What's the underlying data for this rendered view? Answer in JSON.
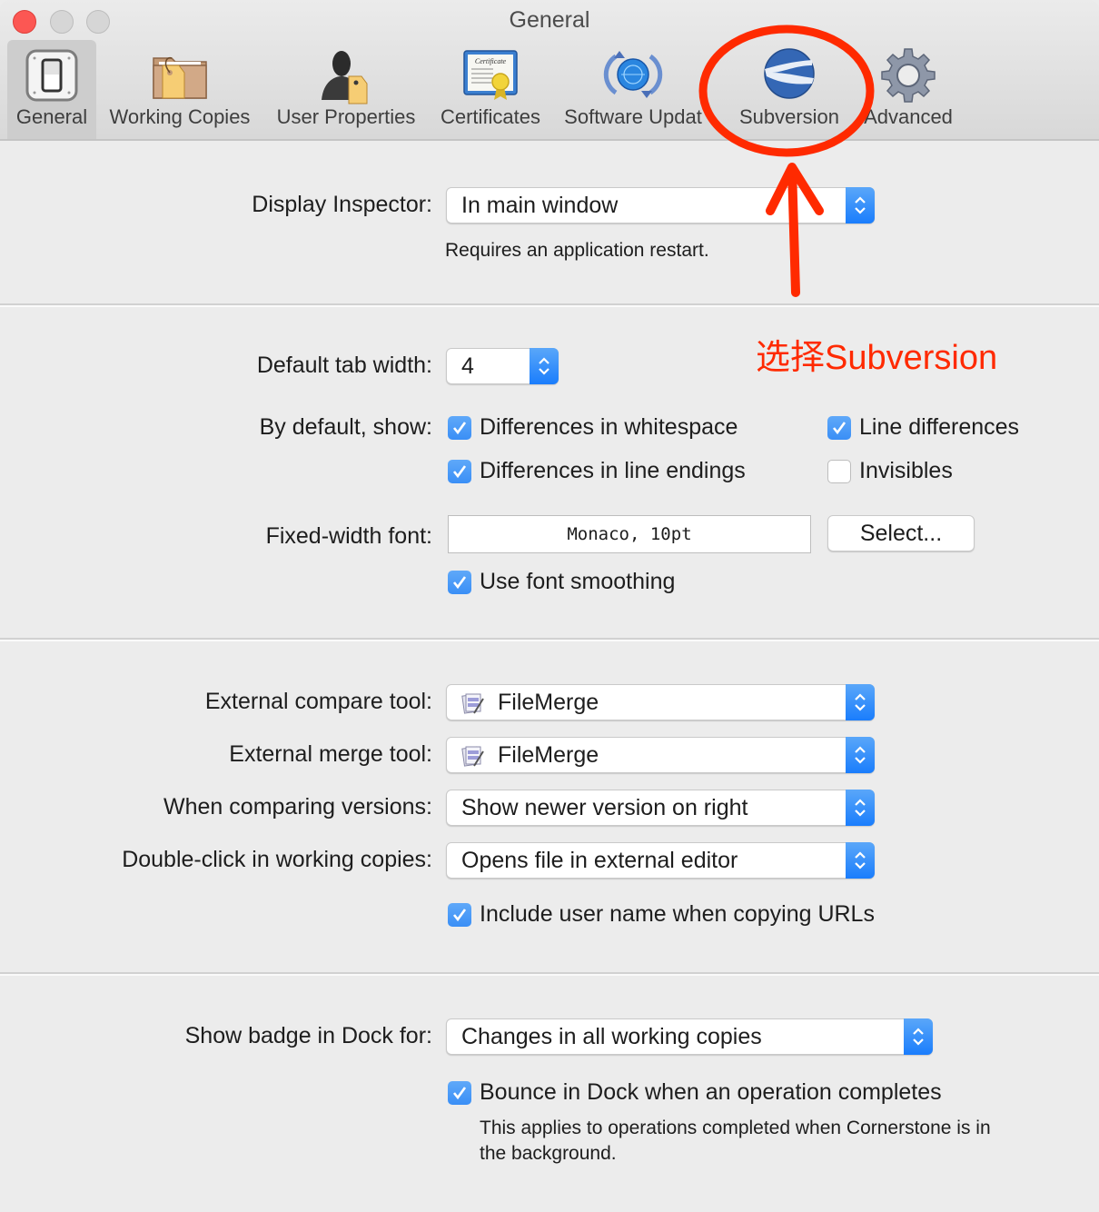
{
  "window": {
    "title": "General",
    "controls": [
      "close",
      "minimize",
      "zoom"
    ]
  },
  "toolbar": {
    "tabs": [
      {
        "label": "General",
        "icon": "switch-icon",
        "selected": true
      },
      {
        "label": "Working Copies",
        "icon": "folder-tag-icon",
        "selected": false
      },
      {
        "label": "User Properties",
        "icon": "user-tag-icon",
        "selected": false
      },
      {
        "label": "Certificates",
        "icon": "certificate-icon",
        "selected": false
      },
      {
        "label": "Software Updat",
        "icon": "software-update-icon",
        "selected": false
      },
      {
        "label": "Subversion",
        "icon": "subversion-icon",
        "selected": false
      },
      {
        "label": "Advanced",
        "icon": "gear-icon",
        "selected": false
      }
    ]
  },
  "section1": {
    "display_inspector_label": "Display Inspector:",
    "display_inspector_value": "In main window",
    "restart_note": "Requires an application restart."
  },
  "section2": {
    "tab_width_label": "Default tab width:",
    "tab_width_value": "4",
    "show_label": "By default, show:",
    "checkboxes": [
      {
        "label": "Differences in whitespace",
        "checked": true
      },
      {
        "label": "Line differences",
        "checked": true
      },
      {
        "label": "Differences in line endings",
        "checked": true
      },
      {
        "label": "Invisibles",
        "checked": false
      }
    ],
    "font_label": "Fixed-width font:",
    "font_value": "Monaco, 10pt",
    "select_button": "Select...",
    "font_smoothing": {
      "label": "Use font smoothing",
      "checked": true
    }
  },
  "section3": {
    "compare_label": "External compare tool:",
    "compare_value": "FileMerge",
    "merge_label": "External merge tool:",
    "merge_value": "FileMerge",
    "comparing_label": "When comparing versions:",
    "comparing_value": "Show newer version on right",
    "doubleclick_label": "Double-click in working copies:",
    "doubleclick_value": "Opens file in external editor",
    "include_user": {
      "label": "Include user name when copying URLs",
      "checked": true
    }
  },
  "section4": {
    "badge_label": "Show badge in Dock for:",
    "badge_value": "Changes in all working copies",
    "bounce": {
      "label": "Bounce in Dock when an operation completes",
      "checked": true
    },
    "bounce_note_line1": "This applies to operations completed when Cornerstone is in",
    "bounce_note_line2": "the background."
  },
  "annotation": {
    "text": "选择Subversion",
    "color": "#ff2a00"
  },
  "colors": {
    "accent": "#3a8ff6",
    "close": "#fc5753",
    "background": "#ececec"
  }
}
